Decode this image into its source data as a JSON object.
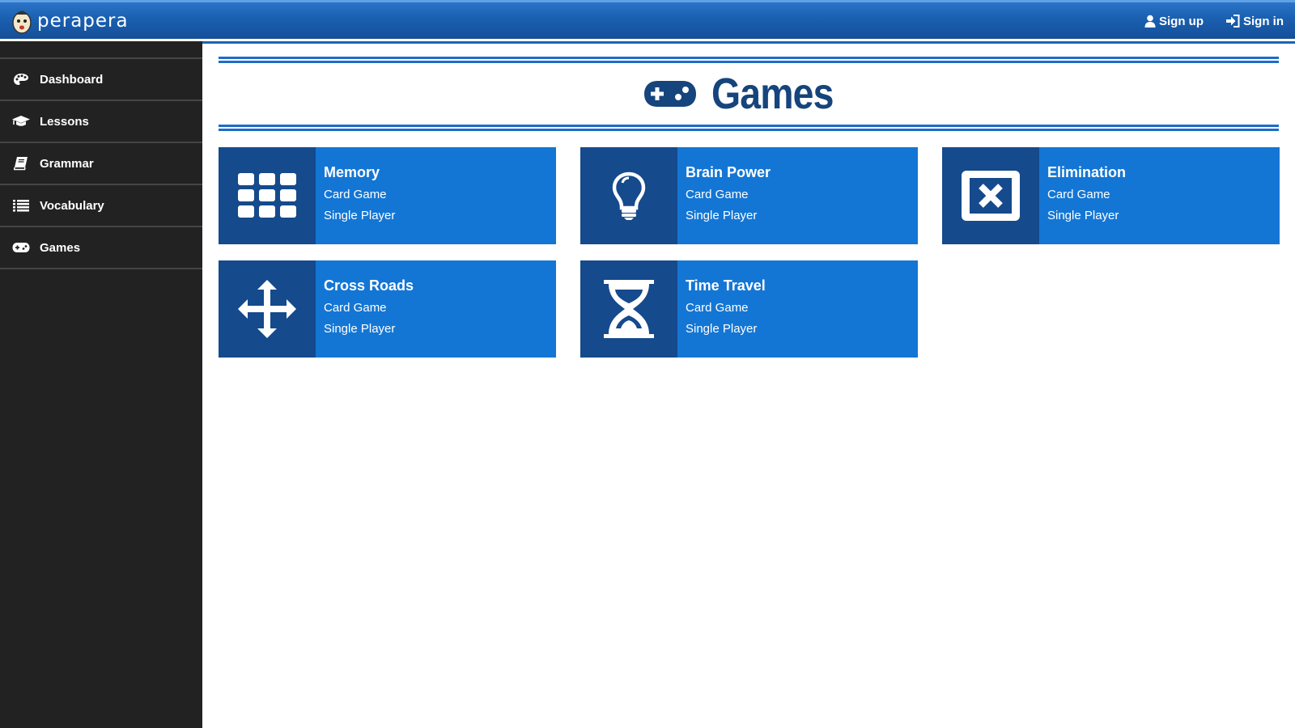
{
  "header": {
    "brand": "perapera",
    "nav": [
      {
        "label": "Sign up",
        "icon": "user-icon"
      },
      {
        "label": "Sign in",
        "icon": "sign-in-icon"
      }
    ]
  },
  "sidebar": {
    "items": [
      {
        "label": "Dashboard",
        "icon": "palette-icon"
      },
      {
        "label": "Lessons",
        "icon": "graduation-cap-icon"
      },
      {
        "label": "Grammar",
        "icon": "book-icon"
      },
      {
        "label": "Vocabulary",
        "icon": "list-icon"
      },
      {
        "label": "Games",
        "icon": "gamepad-icon"
      }
    ]
  },
  "main": {
    "title": "Games",
    "title_icon": "gamepad-icon",
    "games": [
      {
        "title": "Memory",
        "type": "Card Game",
        "players": "Single Player",
        "icon": "grid-icon"
      },
      {
        "title": "Brain Power",
        "type": "Card Game",
        "players": "Single Player",
        "icon": "lightbulb-icon"
      },
      {
        "title": "Elimination",
        "type": "Card Game",
        "players": "Single Player",
        "icon": "close-box-icon"
      },
      {
        "title": "Cross Roads",
        "type": "Card Game",
        "players": "Single Player",
        "icon": "arrows-icon"
      },
      {
        "title": "Time Travel",
        "type": "Card Game",
        "players": "Single Player",
        "icon": "hourglass-icon"
      }
    ]
  },
  "colors": {
    "header": "#1a5fb0",
    "sidebar": "#222222",
    "card": "#1476d4",
    "card_icon_bg": "#154a8c",
    "title": "#16447c"
  }
}
